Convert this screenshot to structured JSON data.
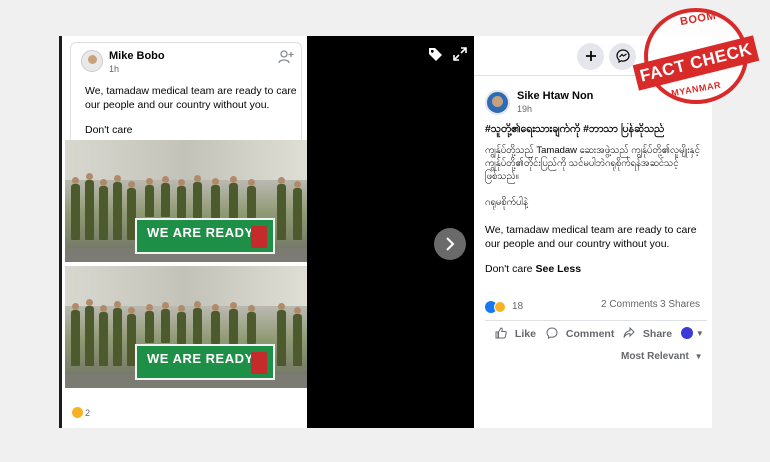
{
  "left_post": {
    "author": "Mike Bobo",
    "time": "1h",
    "text": "We, tamadaw medical team are ready to care our people and our country without you.",
    "text2": "Don't care",
    "banner_text": "WE ARE READY",
    "reaction_count": "2"
  },
  "right_post": {
    "author": "Sike Htaw Non",
    "time": "19h",
    "hashtags": "#သူတို့၏ရေးသားချက်ကို #ဘာသာ ပြန်ဆိုသည်",
    "burmese_text": "ကျွန်ုပ်တို့သည် Tamadaw ဆေးအဖွဲ့သည် ကျွန်ုပ်တို့၏လူမျိုးနှင့်ကျွန်ုပ်တို့၏တိုင်းပြည်ကို သင်မပါဘဲဂရုစိုက်ရန်အဆင်သင့်ဖြစ်သည်။",
    "burmese_text2": "ဂရုမစိုက်ပါနဲ့",
    "english_text": "We, tamadaw medical team are ready to care our people and our country without you.",
    "dont_care": "Don't care",
    "see_less": "See Less",
    "reaction_count": "18",
    "comments": "2 Comments",
    "shares": "3 Shares",
    "actions": {
      "like": "Like",
      "comment": "Comment",
      "share": "Share"
    },
    "sort": "Most Relevant"
  },
  "stamp": {
    "top": "BOOM",
    "main": "FACT CHECK",
    "bottom": "MYANMAR"
  },
  "colors": {
    "stamp_red": "#d92a2a",
    "banner_green": "#1e8f47",
    "facebook_blue": "#1877f2"
  }
}
